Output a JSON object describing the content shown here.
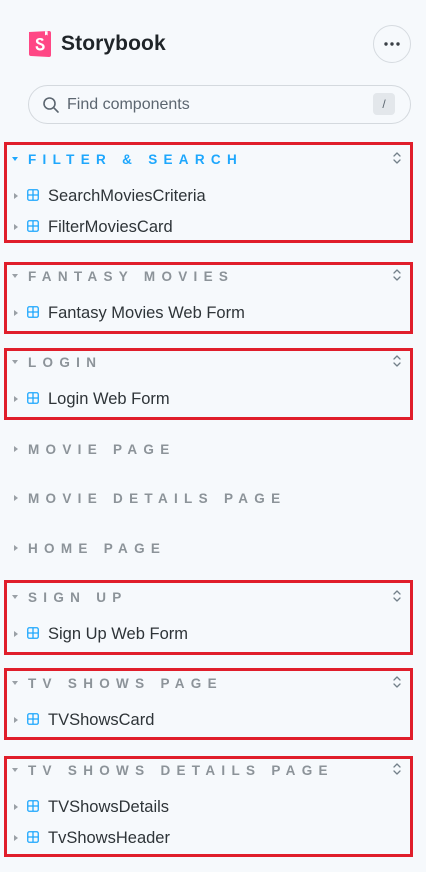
{
  "app": {
    "brand": "Storybook",
    "brand_color": "#ff4785",
    "accent_color": "#1ea7fd"
  },
  "header": {
    "menu_icon": "ellipsis-icon"
  },
  "search": {
    "placeholder": "Find components",
    "shortcut": "/"
  },
  "groups": [
    {
      "title": "FILTER & SEARCH",
      "expanded": true,
      "active": true,
      "items": [
        "SearchMoviesCriteria",
        "FilterMoviesCard"
      ]
    },
    {
      "title": "FANTASY MOVIES",
      "expanded": true,
      "active": false,
      "items": [
        "Fantasy Movies Web Form"
      ]
    },
    {
      "title": "LOGIN",
      "expanded": true,
      "active": false,
      "items": [
        "Login Web Form"
      ]
    },
    {
      "title": "MOVIE PAGE",
      "expanded": false,
      "active": false,
      "items": []
    },
    {
      "title": "MOVIE DETAILS PAGE",
      "expanded": false,
      "active": false,
      "items": []
    },
    {
      "title": "HOME PAGE",
      "expanded": false,
      "active": false,
      "items": []
    },
    {
      "title": "SIGN UP",
      "expanded": true,
      "active": false,
      "items": [
        "Sign Up Web Form"
      ]
    },
    {
      "title": "TV SHOWS PAGE",
      "expanded": true,
      "active": false,
      "items": [
        "TVShowsCard"
      ]
    },
    {
      "title": "TV SHOWS DETAILS PAGE",
      "expanded": true,
      "active": false,
      "items": [
        "TVShowsDetails",
        "TvShowsHeader"
      ]
    }
  ]
}
